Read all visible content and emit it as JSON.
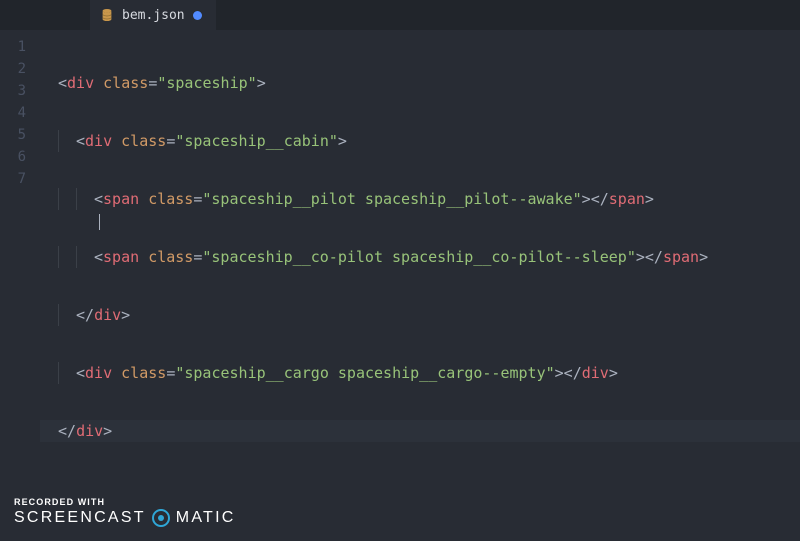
{
  "tab": {
    "filename": "bem.json",
    "icon": "database-icon",
    "dirty": true
  },
  "gutter": [
    "1",
    "2",
    "3",
    "4",
    "5",
    "6",
    "7"
  ],
  "code": {
    "l1": {
      "open": "<",
      "tag": "div",
      "sp": " ",
      "attr": "class",
      "eq": "=",
      "str": "\"spaceship\"",
      "close": ">"
    },
    "l2": {
      "open": "<",
      "tag": "div",
      "sp": " ",
      "attr": "class",
      "eq": "=",
      "str": "\"spaceship__cabin\"",
      "close": ">"
    },
    "l3": {
      "open": "<",
      "tag": "span",
      "sp": " ",
      "attr": "class",
      "eq": "=",
      "str": "\"spaceship__pilot spaceship__pilot--awake\"",
      "close": ">",
      "open2": "</",
      "tag2": "span",
      "close2": ">"
    },
    "l4": {
      "open": "<",
      "tag": "span",
      "sp": " ",
      "attr": "class",
      "eq": "=",
      "str": "\"spaceship__co-pilot spaceship__co-pilot--sleep\"",
      "close": ">",
      "open2": "</",
      "tag2": "span",
      "close2": ">"
    },
    "l5": {
      "open": "</",
      "tag": "div",
      "close": ">"
    },
    "l6": {
      "open": "<",
      "tag": "div",
      "sp": " ",
      "attr": "class",
      "eq": "=",
      "str": "\"spaceship__cargo spaceship__cargo--empty\"",
      "close": ">",
      "open2": "</",
      "tag2": "div",
      "close2": ">"
    },
    "l7": {
      "open": "</",
      "tag": "div",
      "close": ">"
    }
  },
  "watermark": {
    "small": "RECORDED WITH",
    "part1": "SCREENCAST",
    "part2": "MATIC"
  }
}
